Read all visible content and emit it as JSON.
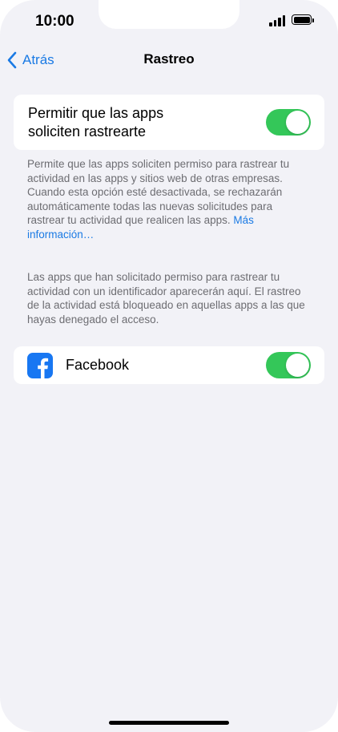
{
  "status_bar": {
    "time": "10:00"
  },
  "nav": {
    "back_label": "Atrás",
    "title": "Rastreo"
  },
  "allow_tracking": {
    "label_line1": "Permitir que las apps",
    "label_line2": "soliciten rastrearte",
    "enabled": true
  },
  "footnote1": {
    "text": "Permite que las apps soliciten permiso para rastrear tu actividad en las apps y sitios web de otras empresas. Cuando esta opción esté desactivada, se rechazarán automáticamente todas las nuevas solicitudes para rastrear tu actividad que realicen las apps.",
    "link": "Más información…"
  },
  "footnote2": {
    "text": "Las apps que han solicitado permiso para rastrear tu actividad con un identificador aparecerán aquí. El rastreo de la actividad está bloqueado en aquellas apps a las que hayas denegado el acceso."
  },
  "apps": [
    {
      "name": "Facebook",
      "icon": "facebook-icon",
      "enabled": true
    }
  ],
  "colors": {
    "accent": "#1a7ae4",
    "toggle_on": "#34c759",
    "background": "#f2f2f7",
    "facebook_brand": "#1877f2"
  }
}
